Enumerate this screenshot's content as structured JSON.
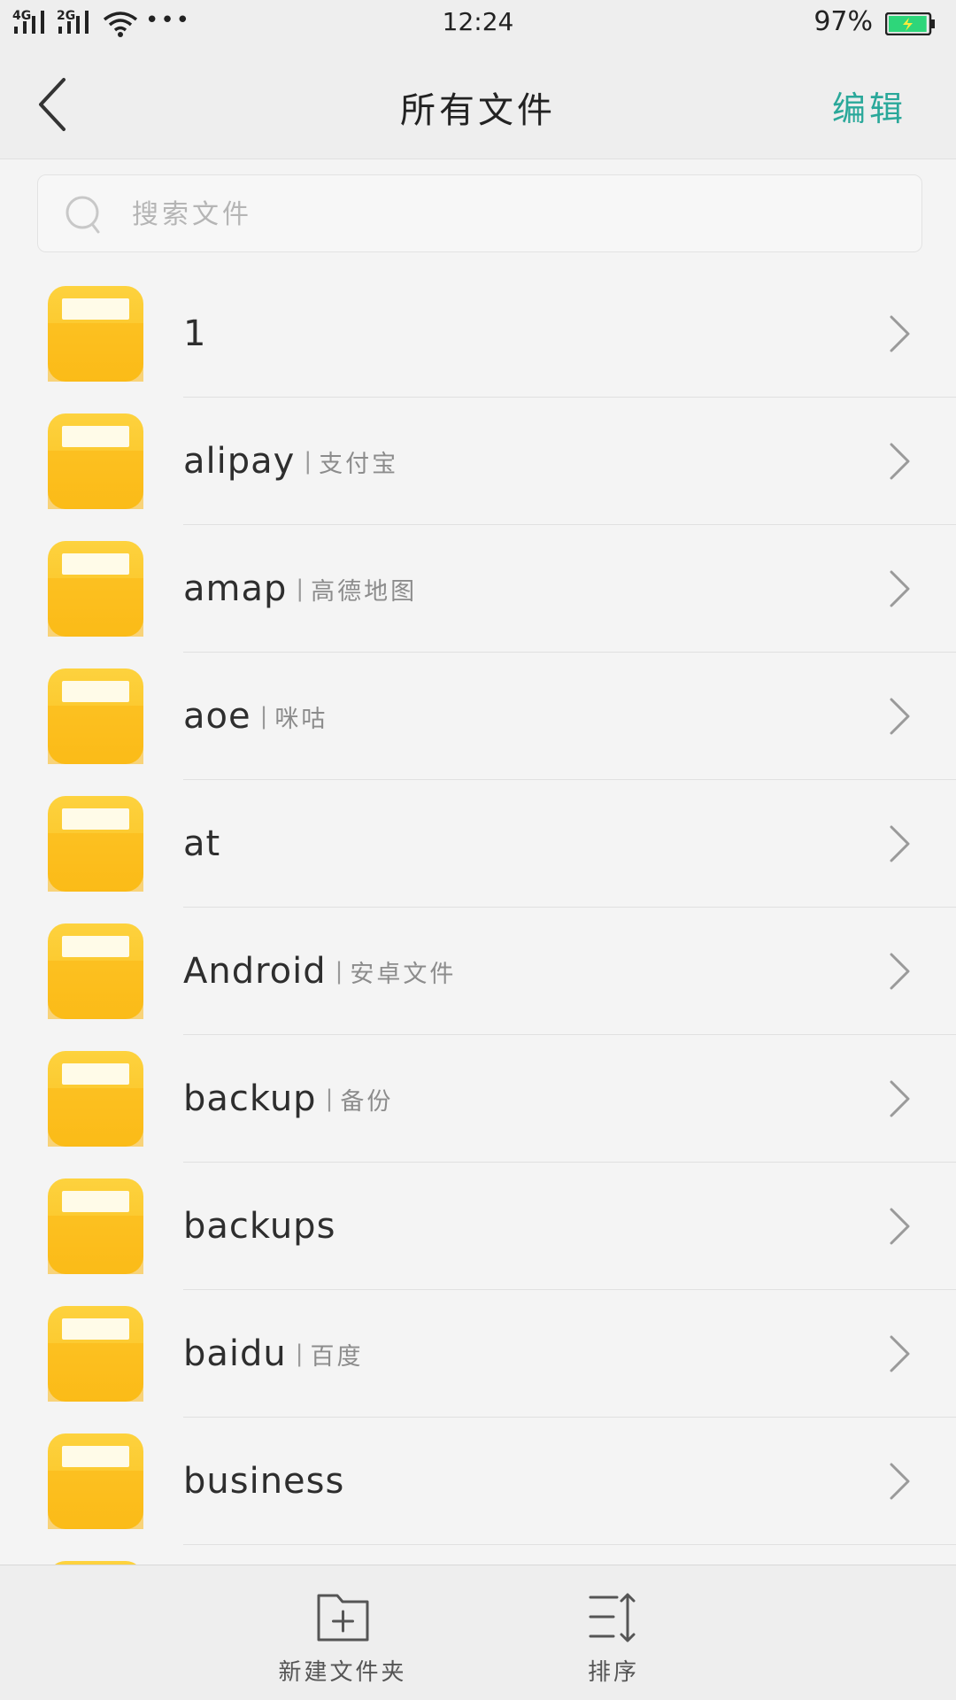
{
  "status_bar": {
    "signal_1": "4G",
    "signal_2": "2G",
    "dots": "•••",
    "time": "12:24",
    "battery_percent": "97%",
    "battery_level": 0.97,
    "battery_color": "#2ed67a"
  },
  "header": {
    "title": "所有文件",
    "edit_label": "编辑",
    "accent_color": "#2aa89a"
  },
  "search": {
    "placeholder": "搜索文件",
    "value": ""
  },
  "files": [
    {
      "name": "1",
      "alias": ""
    },
    {
      "name": "alipay",
      "alias": "支付宝"
    },
    {
      "name": "amap",
      "alias": "高德地图"
    },
    {
      "name": "aoe",
      "alias": "咪咕"
    },
    {
      "name": "at",
      "alias": ""
    },
    {
      "name": "Android",
      "alias": "安卓文件"
    },
    {
      "name": "backup",
      "alias": "备份"
    },
    {
      "name": "backups",
      "alias": ""
    },
    {
      "name": "baidu",
      "alias": "百度"
    },
    {
      "name": "business",
      "alias": ""
    }
  ],
  "folder_color": "#fbbf1d",
  "toolbar": {
    "new_folder_label": "新建文件夹",
    "sort_label": "排序"
  }
}
